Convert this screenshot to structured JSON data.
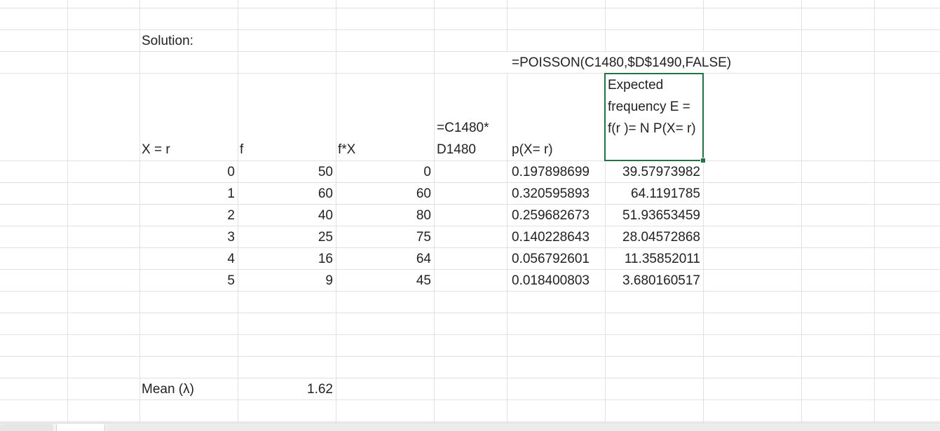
{
  "title": "Solution:",
  "formula_note": "=POISSON(C1480,$D$1490,FALSE)",
  "headers": {
    "x": "X = r",
    "f": "f",
    "fx": "f*X",
    "mult_formula": "=C1480* D1480",
    "p": "p(X= r)",
    "expected": "Expected frequency E = f(r )= N P(X= r)"
  },
  "rows": [
    {
      "x": "0",
      "f": "50",
      "fx": "0",
      "p": "0.197898699",
      "e": "39.57973982"
    },
    {
      "x": "1",
      "f": "60",
      "fx": "60",
      "p": "0.320595893",
      "e": "64.1191785"
    },
    {
      "x": "2",
      "f": "40",
      "fx": "80",
      "p": "0.259682673",
      "e": "51.93653459"
    },
    {
      "x": "3",
      "f": "25",
      "fx": "75",
      "p": "0.140228643",
      "e": "28.04572868"
    },
    {
      "x": "4",
      "f": "16",
      "fx": "64",
      "p": "0.056792601",
      "e": "11.35852011"
    },
    {
      "x": "5",
      "f": "9",
      "fx": "45",
      "p": "0.018400803",
      "e": "3.680160517"
    }
  ],
  "mean": {
    "label": "Mean (λ)",
    "value": "1.62"
  },
  "colors": {
    "gridline": "#e1e1e1",
    "selection": "#217346"
  }
}
